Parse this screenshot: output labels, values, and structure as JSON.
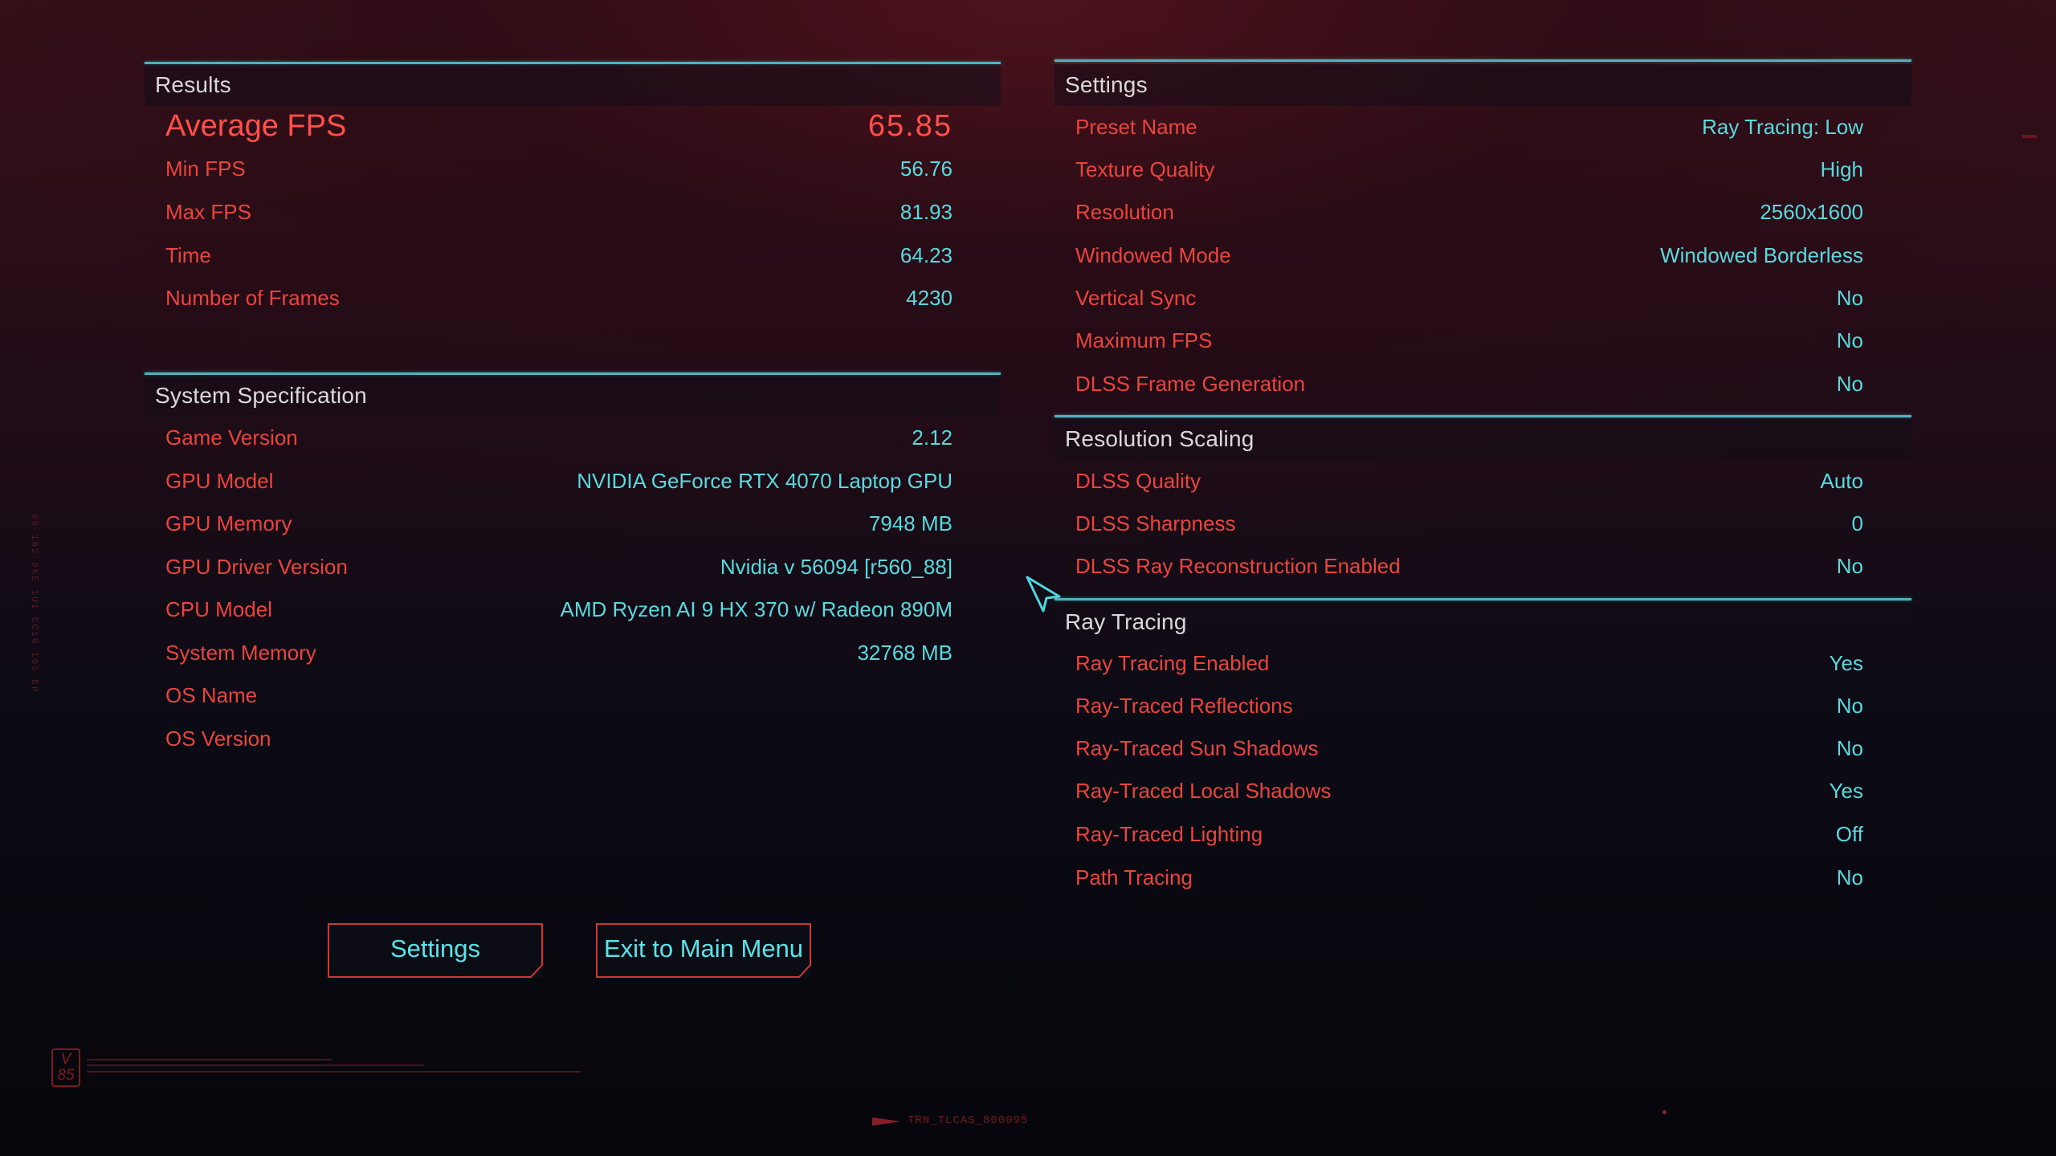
{
  "results": {
    "title": "Results",
    "average_fps": {
      "label": "Average FPS",
      "value": "65.85"
    },
    "rows": [
      {
        "label": "Min FPS",
        "value": "56.76"
      },
      {
        "label": "Max FPS",
        "value": "81.93"
      },
      {
        "label": "Time",
        "value": "64.23"
      },
      {
        "label": "Number of Frames",
        "value": "4230"
      }
    ]
  },
  "system_spec": {
    "title": "System Specification",
    "rows": [
      {
        "label": "Game Version",
        "value": "2.12"
      },
      {
        "label": "GPU Model",
        "value": "NVIDIA GeForce RTX 4070 Laptop GPU"
      },
      {
        "label": "GPU Memory",
        "value": "7948 MB"
      },
      {
        "label": "GPU Driver Version",
        "value": "Nvidia v 56094 [r560_88]"
      },
      {
        "label": "CPU Model",
        "value": "AMD Ryzen AI 9 HX 370 w/ Radeon 890M"
      },
      {
        "label": "System Memory",
        "value": "32768 MB"
      },
      {
        "label": "OS Name",
        "value": ""
      },
      {
        "label": "OS Version",
        "value": ""
      }
    ]
  },
  "settings": {
    "title": "Settings",
    "rows": [
      {
        "label": "Preset Name",
        "value": "Ray Tracing: Low"
      },
      {
        "label": "Texture Quality",
        "value": "High"
      },
      {
        "label": "Resolution",
        "value": "2560x1600"
      },
      {
        "label": "Windowed Mode",
        "value": "Windowed Borderless"
      },
      {
        "label": "Vertical Sync",
        "value": "No"
      },
      {
        "label": "Maximum FPS",
        "value": "No"
      },
      {
        "label": "DLSS Frame Generation",
        "value": "No"
      }
    ]
  },
  "resolution_scaling": {
    "title": "Resolution Scaling",
    "rows": [
      {
        "label": "DLSS Quality",
        "value": "Auto"
      },
      {
        "label": "DLSS Sharpness",
        "value": "0"
      },
      {
        "label": "DLSS Ray Reconstruction Enabled",
        "value": "No"
      }
    ]
  },
  "ray_tracing": {
    "title": "Ray Tracing",
    "rows": [
      {
        "label": "Ray Tracing Enabled",
        "value": "Yes"
      },
      {
        "label": "Ray-Traced Reflections",
        "value": "No"
      },
      {
        "label": "Ray-Traced Sun Shadows",
        "value": "No"
      },
      {
        "label": "Ray-Traced Local Shadows",
        "value": "Yes"
      },
      {
        "label": "Ray-Traced Lighting",
        "value": "Off"
      },
      {
        "label": "Path Tracing",
        "value": "No"
      }
    ]
  },
  "buttons": {
    "settings": "Settings",
    "exit": "Exit to Main Menu"
  },
  "footer": {
    "badge_top": "V",
    "badge_bottom": "85",
    "tag": "TRN_TLCAS_800095"
  },
  "colors": {
    "label_red": "#e8453f",
    "value_cyan": "#5ad9df",
    "divider_teal": "#4fb3bd",
    "header_text": "#d9d9dc"
  }
}
